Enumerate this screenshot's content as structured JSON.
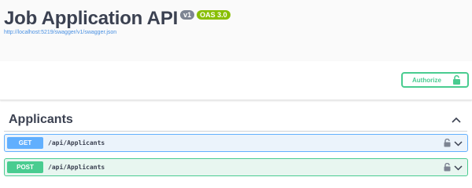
{
  "info": {
    "title": "Job Application API",
    "version_badge": "v1",
    "oas_badge": "OAS 3.0",
    "spec_link": "http://localhost:5219/swagger/v1/swagger.json"
  },
  "authorize": {
    "label": "Authorize",
    "icon": "unlocked-lock-icon"
  },
  "tags": [
    {
      "name": "Applicants",
      "expanded": true,
      "operations": [
        {
          "method": "GET",
          "path": "/api/Applicants",
          "color": "#61affe"
        },
        {
          "method": "POST",
          "path": "/api/Applicants",
          "color": "#49cc90"
        }
      ]
    }
  ],
  "colors": {
    "get": "#61affe",
    "post": "#49cc90",
    "link": "#4990e2",
    "version_badge": "#7d8492",
    "oas_badge": "#89bf04"
  }
}
